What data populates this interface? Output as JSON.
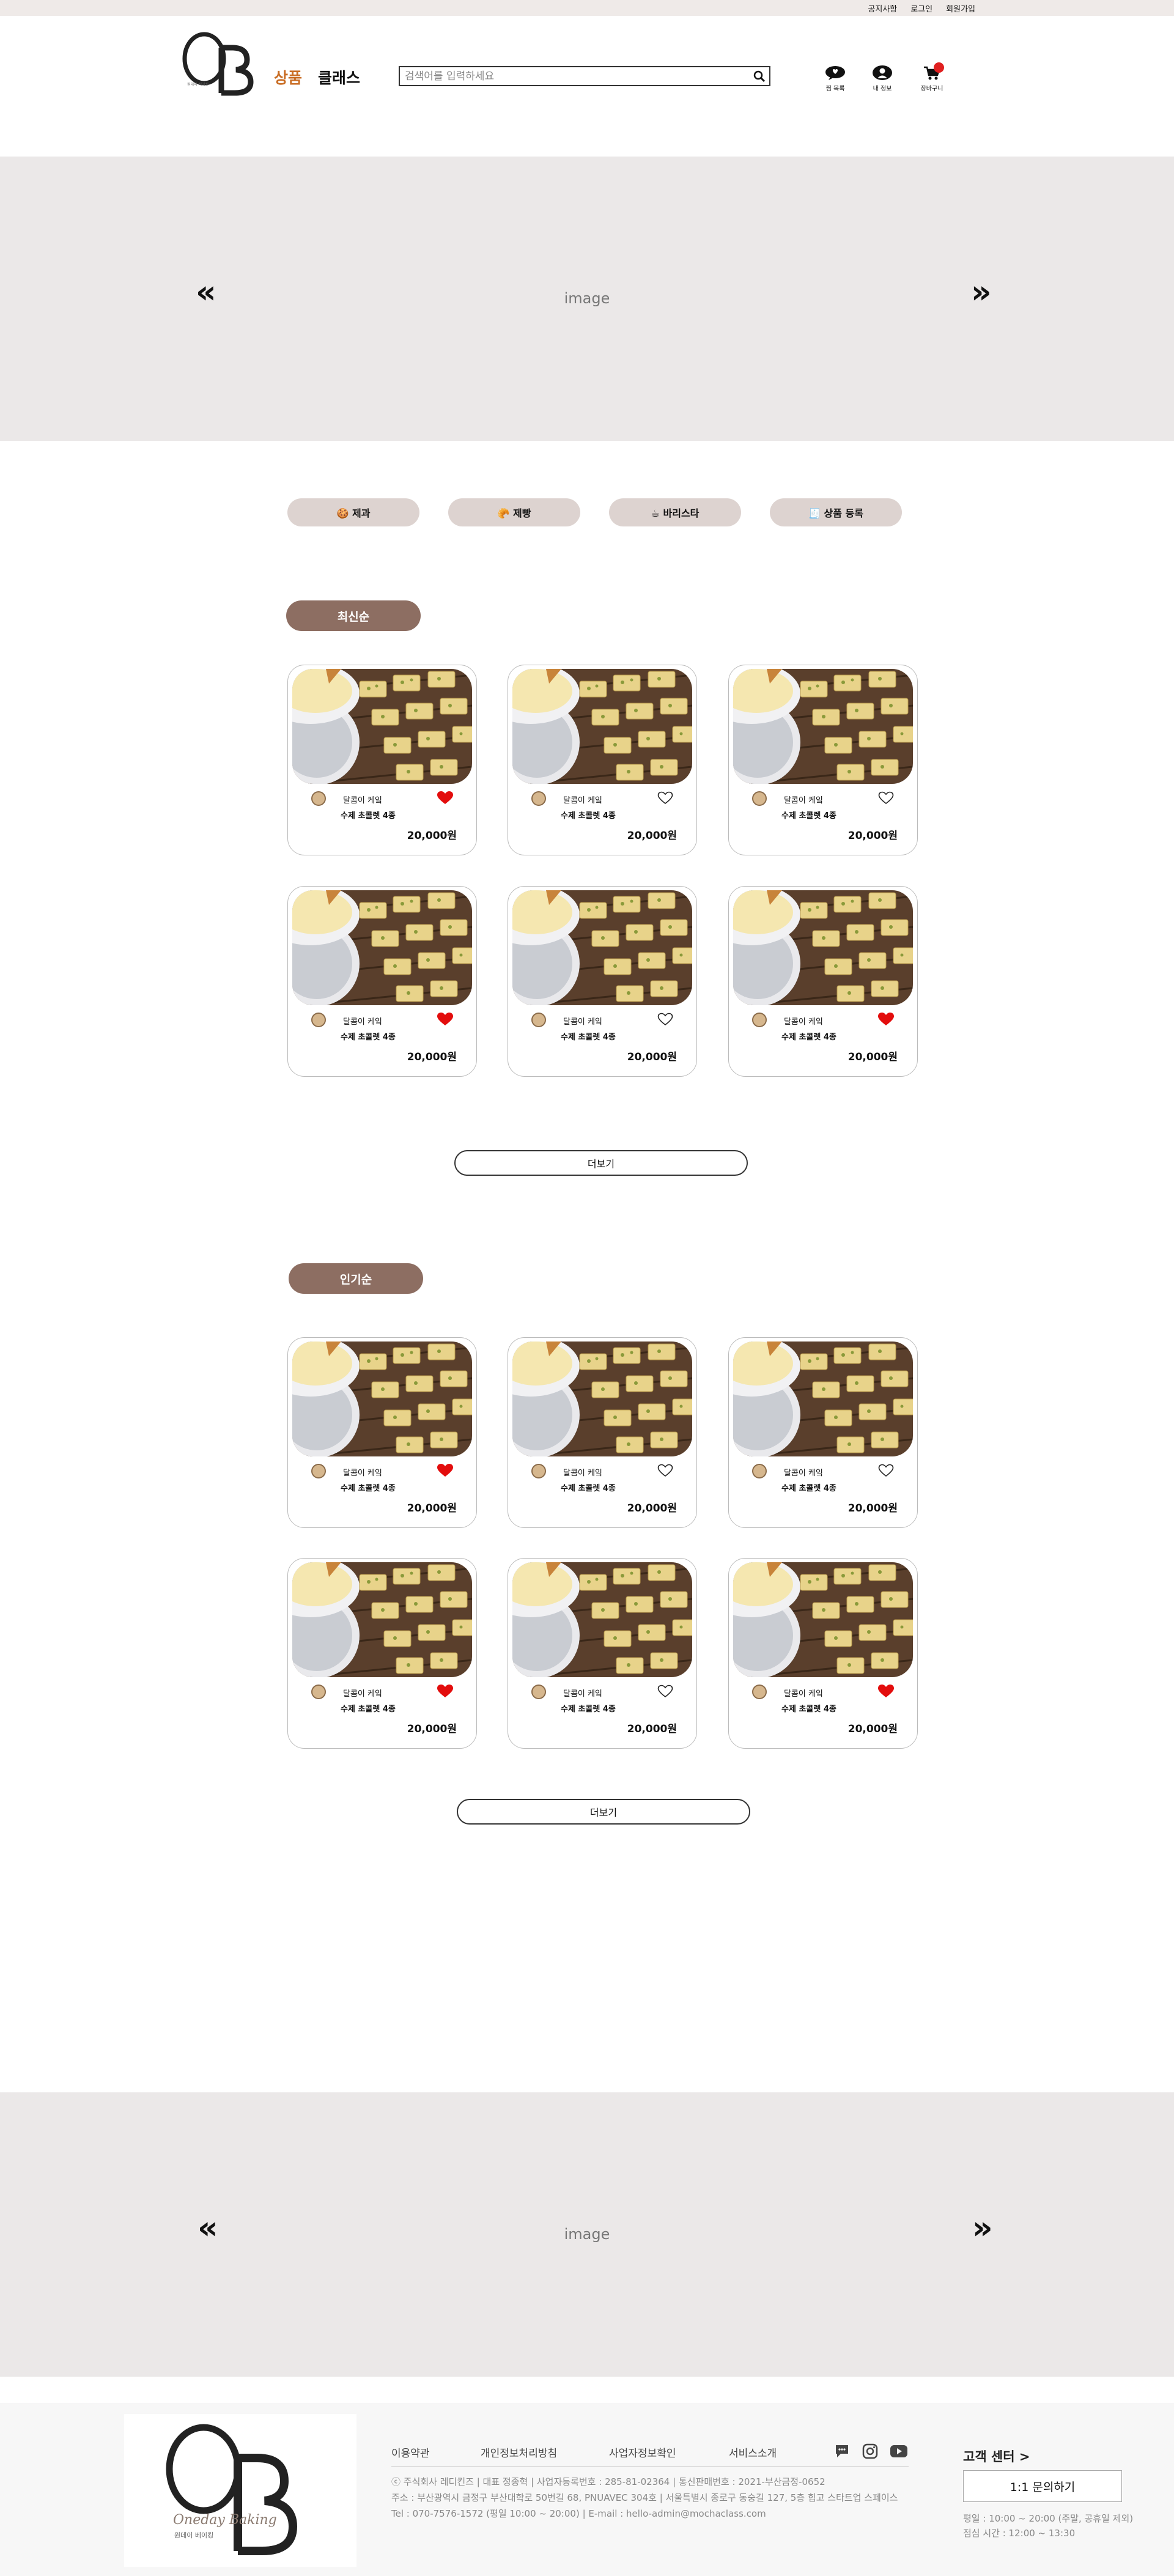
{
  "topbar": {
    "links": [
      "공지사항",
      "로그인",
      "회원가입"
    ]
  },
  "header": {
    "logo_text": "OB",
    "logo_sub": "원데이 베이킹",
    "nav": [
      "상품",
      "클래스"
    ],
    "search_placeholder": "검색어를 입력하세요",
    "icons": [
      {
        "icon": "chat-icon",
        "label": "찜 목록"
      },
      {
        "icon": "user-icon",
        "label": "내 정보"
      },
      {
        "icon": "cart-icon",
        "label": "장바구니"
      }
    ]
  },
  "banner_top": {
    "text": "image",
    "prev": "«",
    "next": "»"
  },
  "categories": [
    "🍪 제과",
    "🥐 제빵",
    "☕ 바리스타",
    "🧾 상품 등록"
  ],
  "sections": [
    {
      "title": "최신순",
      "more_label": "더보기",
      "products": [
        {
          "shop": "달콤이 케잌",
          "name": "수제 초콜렛 4종",
          "price": "20,000원",
          "liked": true
        },
        {
          "shop": "달콤이 케잌",
          "name": "수제 초콜렛 4종",
          "price": "20,000원",
          "liked": false
        },
        {
          "shop": "달콤이 케잌",
          "name": "수제 초콜렛 4종",
          "price": "20,000원",
          "liked": false
        },
        {
          "shop": "달콤이 케잌",
          "name": "수제 초콜렛 4종",
          "price": "20,000원",
          "liked": true
        },
        {
          "shop": "달콤이 케잌",
          "name": "수제 초콜렛 4종",
          "price": "20,000원",
          "liked": false
        },
        {
          "shop": "달콤이 케잌",
          "name": "수제 초콜렛 4종",
          "price": "20,000원",
          "liked": true
        }
      ]
    },
    {
      "title": "인기순",
      "more_label": "더보기",
      "products": [
        {
          "shop": "달콤이 케잌",
          "name": "수제 초콜렛 4종",
          "price": "20,000원",
          "liked": true
        },
        {
          "shop": "달콤이 케잌",
          "name": "수제 초콜렛 4종",
          "price": "20,000원",
          "liked": false
        },
        {
          "shop": "달콤이 케잌",
          "name": "수제 초콜렛 4종",
          "price": "20,000원",
          "liked": false
        },
        {
          "shop": "달콤이 케잌",
          "name": "수제 초콜렛 4종",
          "price": "20,000원",
          "liked": true
        },
        {
          "shop": "달콤이 케잌",
          "name": "수제 초콜렛 4종",
          "price": "20,000원",
          "liked": false
        },
        {
          "shop": "달콤이 케잌",
          "name": "수제 초콜렛 4종",
          "price": "20,000원",
          "liked": true
        }
      ]
    }
  ],
  "banner_bottom": {
    "text": "image",
    "prev": "«",
    "next": "»"
  },
  "footer": {
    "logo_script": "Oneday Baking",
    "links": [
      "이용약관",
      "개인정보처리방침",
      "사업자정보확인",
      "서비스소개"
    ],
    "info": [
      "ⓒ 주식회사 레디킨즈 | 대표 정종혁 | 사업자등록번호 : 285-81-02364 | 통신판매번호 : 2021-부산금정-0652",
      "주소 : 부산광역시 금정구 부산대학로 50번길 68, PNUAVEC 304호 | 서울특별시 종로구 동숭길 127, 5층 힙고 스타트업 스페이스",
      "Tel : 070-7576-1572 (평일 10:00 ~ 20:00) | E-mail : hello-admin@mochaclass.com"
    ],
    "cs_title": "고객 센터 >",
    "cs_button": "1:1 문의하기",
    "cs_hours": [
      "평일 : 10:00 ~ 20:00 (주말, 공휴일 제외)",
      "점심 시간 : 12:00 ~ 13:30"
    ]
  },
  "colors": {
    "accent": "#c96d24",
    "pill": "#8d6e62",
    "category": "#ddd3d0",
    "heart": "#e30d0d"
  }
}
